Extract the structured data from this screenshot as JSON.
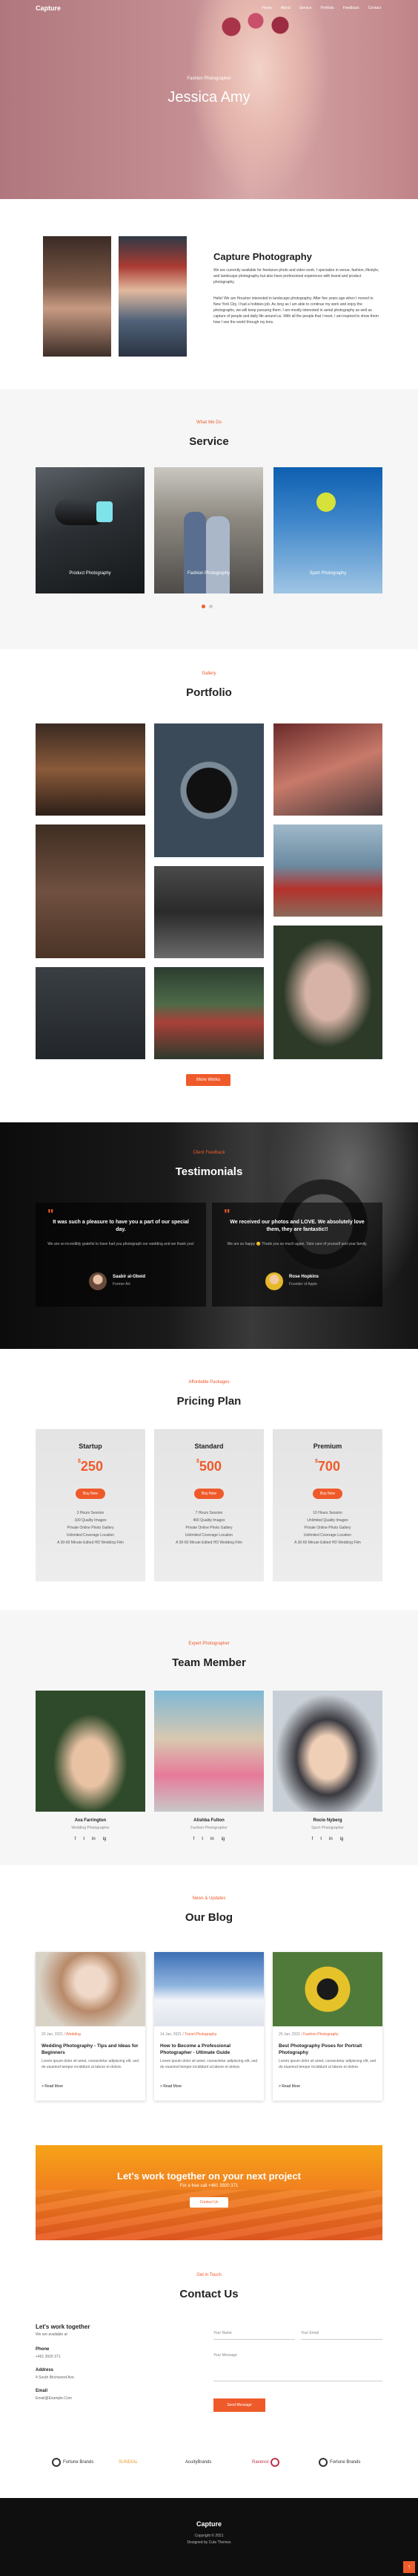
{
  "header": {
    "logo": "Capture",
    "nav": [
      "Home",
      "About",
      "Service",
      "Portfolio",
      "Feedback",
      "Contact"
    ]
  },
  "hero": {
    "subtitle": "Fashion Photographer",
    "title": "Jessica Amy"
  },
  "about": {
    "title": "Capture Photography",
    "lead": "We are currently available for freelance photo and video work. I specialize in venue, fashion, lifestyle, and landscape photography but also have professional experience with brand and product photography.",
    "body": "Hello! We are Houston interested in landscape photography. After five years ago when I moved to New York City, I had a hobbies job. As long as I am able to continue my work and enjoy the photographs, we will keep pursuing them. I am mostly interested in aerial photography as well as capture of people and daily life around us. With all the people that I meet, I am inspired to show them how I see the world through my lens."
  },
  "service": {
    "subtitle": "What We Do",
    "title": "Service",
    "items": [
      {
        "label": "Product Photography",
        "icon": "hair-dryer-photo"
      },
      {
        "label": "Fashion Photography",
        "icon": "couple-photo"
      },
      {
        "label": "Sport Photography",
        "icon": "tennis-ball-photo"
      }
    ]
  },
  "portfolio": {
    "subtitle": "Gallery",
    "title": "Portfolio",
    "button": "More Works"
  },
  "testimonials": {
    "subtitle": "Client Feedback",
    "title": "Testimonials",
    "items": [
      {
        "quote": "It was such a pleasure to have you a part of our special day.",
        "text": "We are so incredibly grateful to have had you photograph our wedding and we thank you!",
        "name": "Saabir al-Obeid",
        "role": "Former Art"
      },
      {
        "quote": "We received our photos and LOVE. We absolutely love them, they are fantastic!!",
        "text": "We are so happy 😊 Thank you so much again. Take care of yourself and your family.",
        "name": "Rose Hopkins",
        "role": "Founder of Apple"
      }
    ]
  },
  "pricing": {
    "subtitle": "Affordable Packages",
    "title": "Pricing Plan",
    "currency": "$",
    "button": "Buy Now",
    "plans": [
      {
        "name": "Startup",
        "price": "250",
        "features": [
          "3 Hours Session",
          "100 Quality Images",
          "Private Online Photo Gallery",
          "Unlimited Coverage Location",
          "A 30-60 Minute Edited HD Wedding Film"
        ]
      },
      {
        "name": "Standard",
        "price": "500",
        "features": [
          "7 Hours Session",
          "400 Quality Images",
          "Private Online Photo Gallery",
          "Unlimited Coverage Location",
          "A 30-60 Minute Edited HD Wedding Film"
        ]
      },
      {
        "name": "Premium",
        "price": "700",
        "features": [
          "10 Hours Session",
          "Unlimited Quality Images",
          "Private Online Photo Gallery",
          "Unlimited Coverage Location",
          "A 30-60 Minute Edited HD Wedding Film"
        ]
      }
    ]
  },
  "team": {
    "subtitle": "Expert Photographer",
    "title": "Team Member",
    "members": [
      {
        "name": "Ava Farrington",
        "role": "Wedding Photographer"
      },
      {
        "name": "Alishba Fulton",
        "role": "Fashion Photographer"
      },
      {
        "name": "Rocio Nyberg",
        "role": "Sport Photographer"
      }
    ],
    "social": [
      "f",
      "t",
      "in",
      "ig"
    ]
  },
  "blog": {
    "subtitle": "News & Updates",
    "title": "Our Blog",
    "read_more": "> Read More",
    "posts": [
      {
        "date": "20 Jan, 2021",
        "sep": "/",
        "cat": "Wedding",
        "title": "Wedding Photography - Tips and Ideas for Beginners",
        "excerpt": "Lorem ipsum dolor sit amet, consectetur adipiscing elit, sed do eiusmod tempor incididunt ut labore et dolore."
      },
      {
        "date": "14 Jan, 2021",
        "sep": "/",
        "cat": "Travel Photography",
        "title": "How to Become a Professional Photographer - Ultimate Guide",
        "excerpt": "Lorem ipsum dolor sit amet, consectetur adipiscing elit, sed do eiusmod tempor incididunt ut labore et dolore."
      },
      {
        "date": "25 Jan, 2021",
        "sep": "/",
        "cat": "Fashion Photography",
        "title": "Best Photography Poses for Portrait Photography",
        "excerpt": "Lorem ipsum dolor sit amet, consectetur adipiscing elit, sed do eiusmod tempor incididunt ut labore et dolore."
      }
    ]
  },
  "cta": {
    "title": "Let's work together on your next project",
    "phone": "For a free call +461 3920 371",
    "button": "Contact Us"
  },
  "contact": {
    "subtitle": "Get in Touch",
    "title": "Contact Us",
    "heading": "Let's work together",
    "note": "We are available at",
    "phone_label": "Phone",
    "phone": "+461 3920 371",
    "address_label": "Address",
    "address": "4 South Birchwood Ave.",
    "email_label": "Email",
    "email": "Email@Example.Com",
    "name_placeholder": "Your Name",
    "email_placeholder": "Your Email",
    "message_placeholder": "Your Message",
    "button": "Send Message"
  },
  "brands": [
    "Fortune Brands",
    "SUNDIAL",
    "AcuityBrands",
    "Ravenol",
    "Fortune Brands"
  ],
  "footer": {
    "title": "Capture",
    "copyright": "Copyright © 2021",
    "credit": "Designed by Cute Themes"
  },
  "colors": {
    "accent": "#ef5a2a",
    "dark": "#0f0f0f"
  }
}
